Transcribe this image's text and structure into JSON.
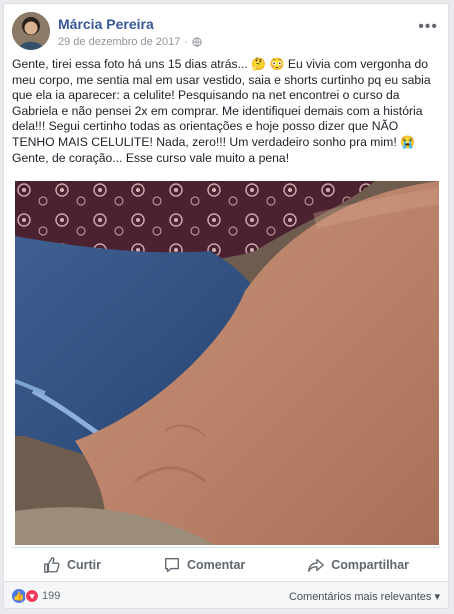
{
  "post": {
    "author": "Márcia Pereira",
    "date": "29 de dezembro de 2017",
    "separator": "·",
    "more_label": "•••",
    "text_before_emoji": "Gente, tirei essa foto há uns 15 dias atrás... ",
    "text_after_emoji": " Eu vivia com vergonha do meu corpo, me sentia mal em usar vestido, saia e shorts curtinho pq eu sabia que ela ia aparecer: a celulite! Pesquisando na net encontrei o curso da Gabriela e não pensei 2x em comprar. Me identifiquei demais com a história dela!!! Segui certinho todas as orientações e hoje posso dizer que NÃO TENHO MAIS CELULITE! Nada, zero!!! Um verdadeiro sonho pra mim! ",
    "text_end": "Gente, de coração... Esse curso vale muito a pena!",
    "emojis": [
      "🤔",
      "😳",
      "😭"
    ]
  },
  "actions": {
    "like": "Curtir",
    "comment": "Comentar",
    "share": "Compartilhar"
  },
  "footer": {
    "reaction_count": "199",
    "sort_label": "Comentários mais relevantes ▾"
  },
  "icons": [
    "globe-icon",
    "like-icon",
    "comment-icon",
    "share-icon",
    "more-icon"
  ],
  "colors": {
    "name": "#385898",
    "like_reaction": "#4b7bea",
    "love_reaction": "#ef3b5b"
  }
}
